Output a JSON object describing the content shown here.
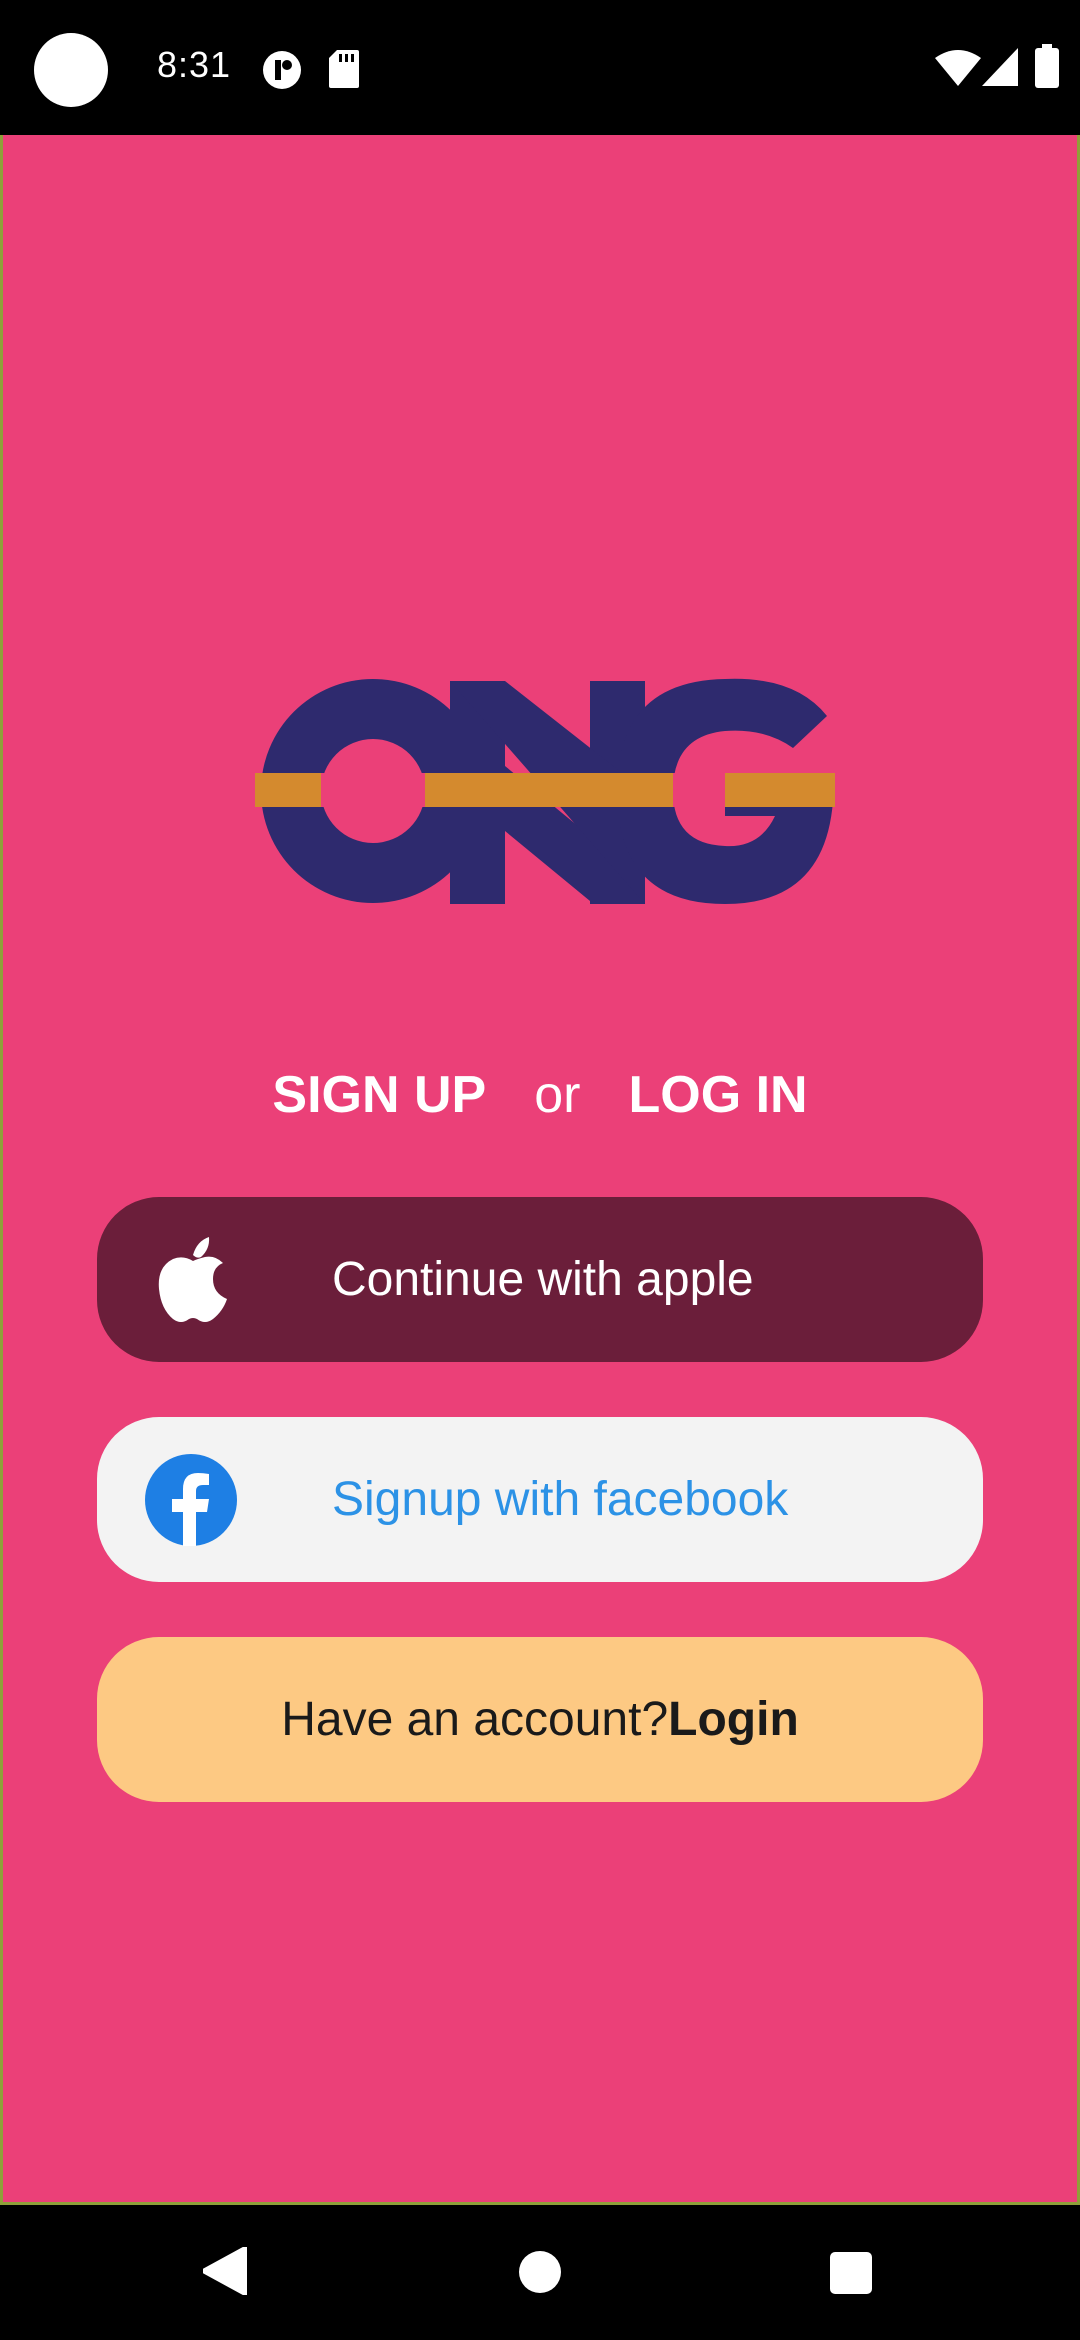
{
  "status_bar": {
    "time": "8:31",
    "icons": [
      "notification-icon",
      "sd-card-icon",
      "wifi-icon",
      "signal-icon",
      "battery-icon"
    ]
  },
  "app": {
    "background_color": "#EB4078",
    "logo": {
      "text": "ONG",
      "colors": {
        "letters": "#2E2A6E",
        "bar": "#D48A2E"
      }
    },
    "heading": {
      "signup": "SIGN UP",
      "or": "or",
      "login": "LOG IN"
    },
    "buttons": {
      "apple": {
        "label": "Continue with apple",
        "icon": "apple-icon",
        "color": "#6B1E3A"
      },
      "facebook": {
        "label": "Signup with facebook",
        "icon": "facebook-icon",
        "color": "#F3F3F3",
        "text_color": "#2C92E6"
      },
      "login": {
        "prefix": "Have an account?",
        "action": "Login",
        "color": "#FDC983"
      }
    }
  },
  "nav_bar": {
    "icons": [
      "back-icon",
      "home-icon",
      "recents-icon"
    ]
  }
}
